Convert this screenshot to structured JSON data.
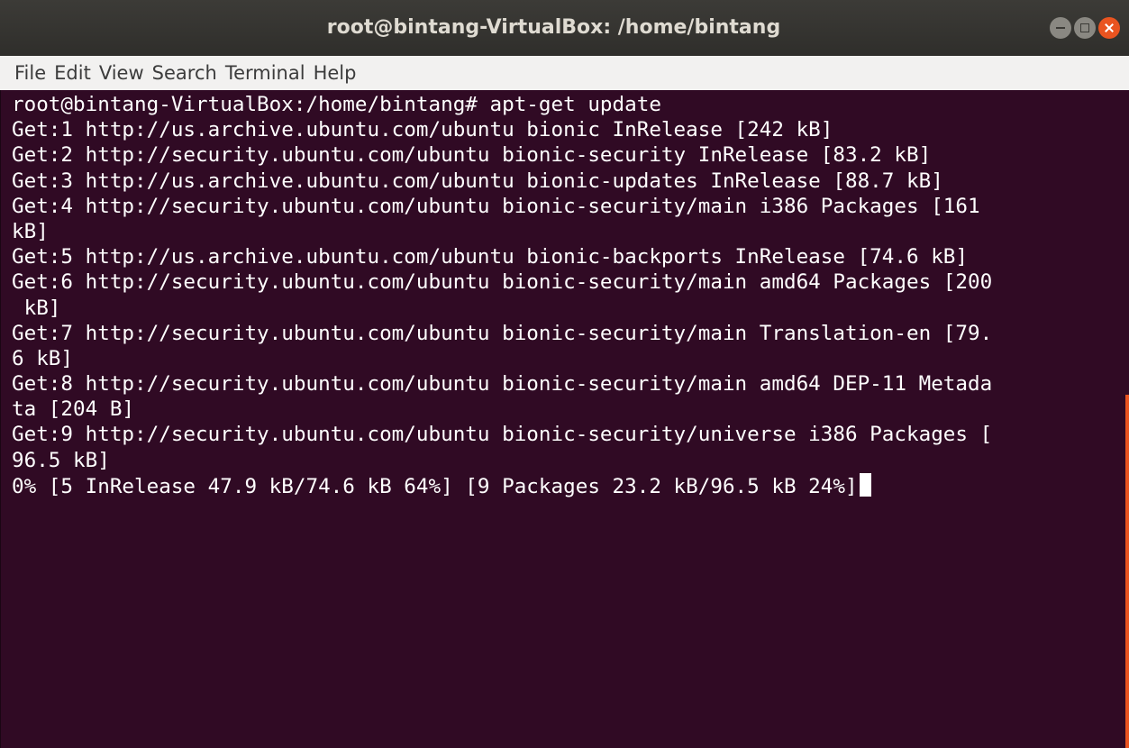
{
  "window": {
    "title": "root@bintang-VirtualBox: /home/bintang"
  },
  "menu": {
    "items": [
      "File",
      "Edit",
      "View",
      "Search",
      "Terminal",
      "Help"
    ]
  },
  "terminal": {
    "lines": [
      "root@bintang-VirtualBox:/home/bintang# apt-get update",
      "Get:1 http://us.archive.ubuntu.com/ubuntu bionic InRelease [242 kB]",
      "Get:2 http://security.ubuntu.com/ubuntu bionic-security InRelease [83.2 kB]",
      "Get:3 http://us.archive.ubuntu.com/ubuntu bionic-updates InRelease [88.7 kB]",
      "Get:4 http://security.ubuntu.com/ubuntu bionic-security/main i386 Packages [161",
      "kB]",
      "Get:5 http://us.archive.ubuntu.com/ubuntu bionic-backports InRelease [74.6 kB]",
      "Get:6 http://security.ubuntu.com/ubuntu bionic-security/main amd64 Packages [200",
      " kB]",
      "Get:7 http://security.ubuntu.com/ubuntu bionic-security/main Translation-en [79.",
      "6 kB]",
      "Get:8 http://security.ubuntu.com/ubuntu bionic-security/main amd64 DEP-11 Metada",
      "ta [204 B]",
      "Get:9 http://security.ubuntu.com/ubuntu bionic-security/universe i386 Packages [",
      "96.5 kB]",
      "0% [5 InRelease 47.9 kB/74.6 kB 64%] [9 Packages 23.2 kB/96.5 kB 24%]"
    ]
  },
  "colors": {
    "terminal_bg": "#300a24",
    "accent": "#e95420",
    "titlebar": "#3c3b37",
    "menubar": "#f2f1f0"
  },
  "icons": {
    "minimize": "minimize-icon",
    "maximize": "maximize-icon",
    "close": "close-icon"
  }
}
